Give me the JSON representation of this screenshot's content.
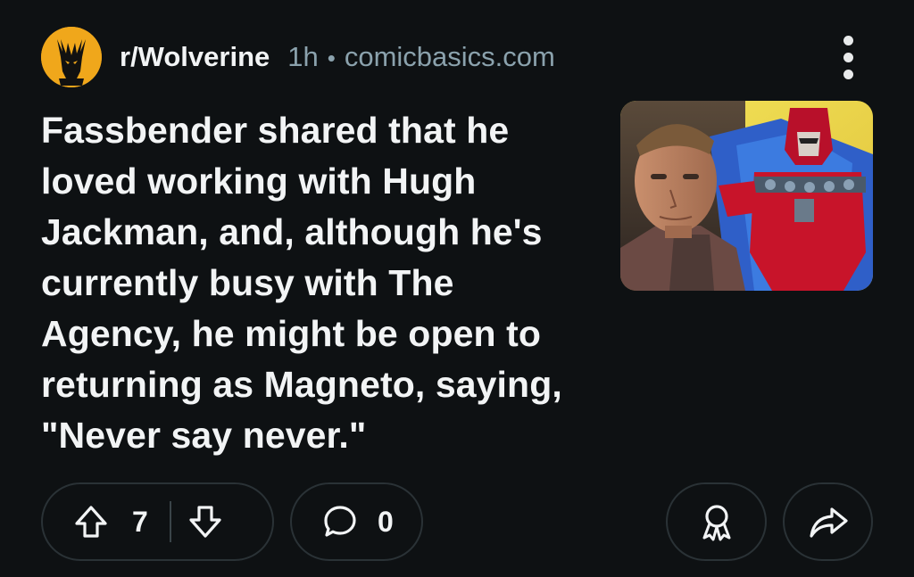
{
  "post": {
    "subreddit": "r/Wolverine",
    "age": "1h",
    "separator": "•",
    "domain": "comicbasics.com",
    "title": "Fassbender shared that he loved working with Hugh Jackman, and, although he's currently busy with The Agency, he might be open to returning as Magneto, saying, \"Never say never.\"",
    "thumbnail_icon": "magneto-thumbnail"
  },
  "actions": {
    "upvote_icon": "arrow-up-icon",
    "vote_count": "7",
    "downvote_icon": "arrow-down-icon",
    "comment_icon": "comment-bubble-icon",
    "comment_count": "0",
    "award_icon": "award-icon",
    "share_icon": "share-arrow-icon"
  },
  "colors": {
    "background": "#0e1113",
    "text": "#f2f4f5",
    "meta": "#8ba2ad",
    "pill_border": "#2a3236",
    "avatar_bg": "#f0a71b"
  }
}
